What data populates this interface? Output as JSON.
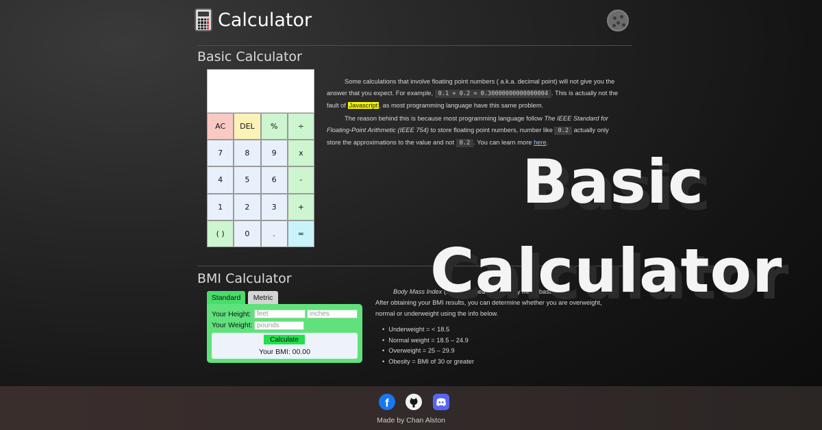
{
  "header": {
    "title": "Calculator",
    "icon": "calculator-icon",
    "theme_icon": "cookie-icon"
  },
  "basic": {
    "section_title": "Basic Calculator",
    "display_value": "",
    "keys": [
      {
        "label": "AC",
        "kind": "ac"
      },
      {
        "label": "DEL",
        "kind": "del"
      },
      {
        "label": "%",
        "kind": "op"
      },
      {
        "label": "÷",
        "kind": "op"
      },
      {
        "label": "7",
        "kind": "num"
      },
      {
        "label": "8",
        "kind": "num"
      },
      {
        "label": "9",
        "kind": "num"
      },
      {
        "label": "x",
        "kind": "op"
      },
      {
        "label": "4",
        "kind": "num"
      },
      {
        "label": "5",
        "kind": "num"
      },
      {
        "label": "6",
        "kind": "num"
      },
      {
        "label": "-",
        "kind": "op"
      },
      {
        "label": "1",
        "kind": "num"
      },
      {
        "label": "2",
        "kind": "num"
      },
      {
        "label": "3",
        "kind": "num"
      },
      {
        "label": "+",
        "kind": "op"
      },
      {
        "label": "( )",
        "kind": "op"
      },
      {
        "label": "0",
        "kind": "num"
      },
      {
        "label": ".",
        "kind": "num"
      },
      {
        "label": "=",
        "kind": "eq"
      }
    ],
    "para1": {
      "t1": "Some calculations that involve floating point numbers ( a.k.a. decimal point) will not give you the answer that you expect. For example,",
      "code1": "0.1 + 0.2 = 0.30000000000000004",
      "t2": ". This is actually not the fault of",
      "highlight": "Javascript",
      "t3": ", as most programming language have this same problem."
    },
    "para2": {
      "t1": "The reason behind this is because most programming language follow",
      "em": "The IEEE Standard for Floating-Point Arithmetic (IEEE 754)",
      "t2": "to store floating point numbers, number like",
      "code1": "0.2",
      "t3": "actually only store the approximations to the value and not",
      "code2": "0.2",
      "t4": ". You can learn more",
      "link": "here",
      "t5": "."
    }
  },
  "bmi": {
    "section_title": "BMI Calculator",
    "tabs": [
      "Standard",
      "Metric"
    ],
    "height_label": "Your Height:",
    "weight_label": "Your Weight:",
    "height_ph_feet": "feet",
    "height_ph_inches": "inches",
    "weight_ph": "pounds",
    "calculate_label": "Calculate",
    "result": "Your BMI: 00.00",
    "desc_em": "Body Mass Index",
    "desc_mid": "(BMI) is a measure of body mass based",
    "desc_rest": "After obtaining your BMI results, you can determine whether you are overweight, normal or underweight using the info below.",
    "ranges": [
      "Underweight = < 18.5",
      "Normal weight = 18.5 – 24.9",
      "Overweight = 25 – 29.9",
      "Obesity = BMI of 30 or greater"
    ]
  },
  "overlay": {
    "line1": "Basic",
    "line2": "Calculator"
  },
  "footer": {
    "made_by": "Made by Chan Alston",
    "facebook_glyph": "f",
    "social_icons": [
      "facebook-icon",
      "github-icon",
      "discord-icon"
    ]
  }
}
